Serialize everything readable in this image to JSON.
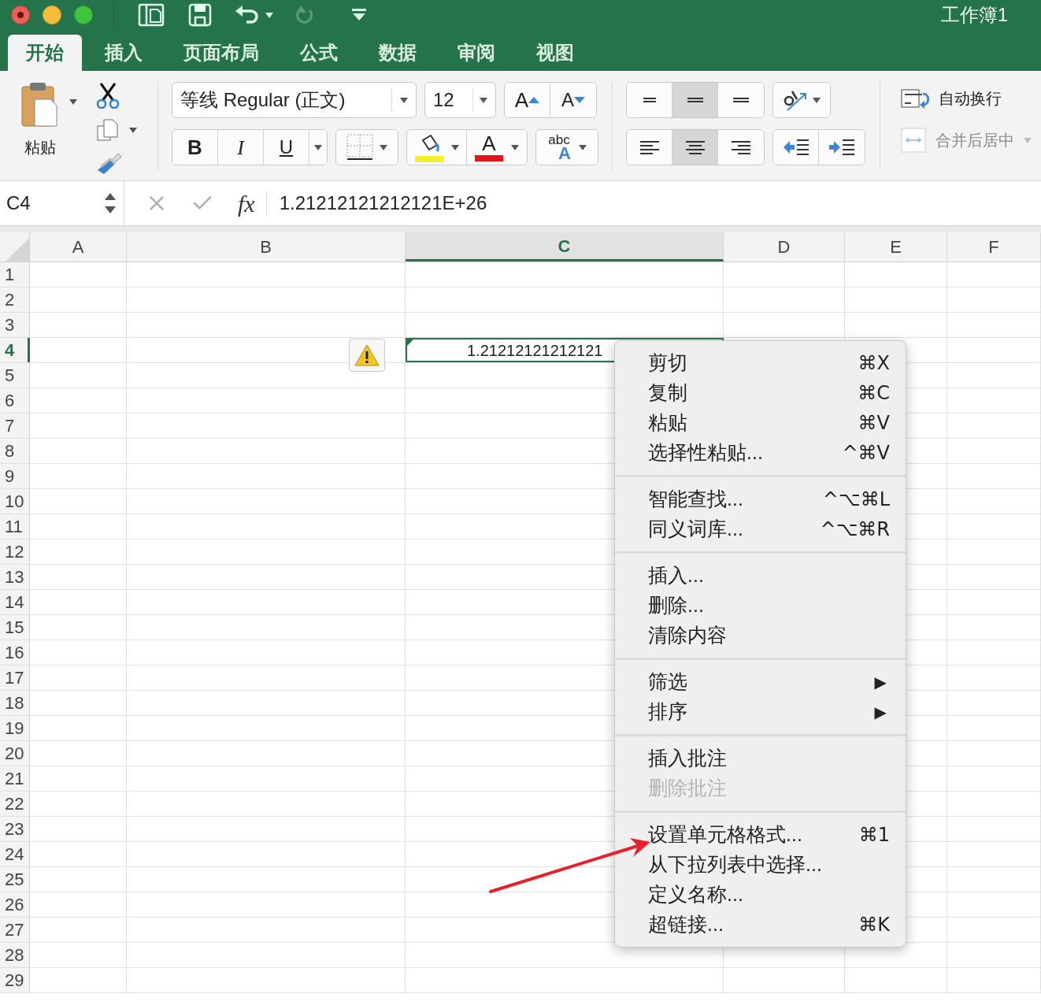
{
  "window": {
    "title": "工作簿1"
  },
  "quick_access": {
    "redo": {
      "disabled": true
    }
  },
  "ribbon_tabs": [
    {
      "label": "开始",
      "selected": true
    },
    {
      "label": "插入",
      "selected": false
    },
    {
      "label": "页面布局",
      "selected": false
    },
    {
      "label": "公式",
      "selected": false
    },
    {
      "label": "数据",
      "selected": false
    },
    {
      "label": "审阅",
      "selected": false
    },
    {
      "label": "视图",
      "selected": false
    }
  ],
  "ribbon": {
    "paste_label": "粘贴",
    "font_name": "等线 Regular (正文)",
    "font_size": "12",
    "grow_font": "A",
    "shrink_font": "A",
    "bold": "B",
    "italic": "I",
    "underline": "U",
    "font_color_letter": "A",
    "text_effects": {
      "top": "abc",
      "bottom": "A"
    },
    "vertical_align": [
      {
        "selected": false
      },
      {
        "selected": true
      },
      {
        "selected": false
      }
    ],
    "horizontal_align": [
      {
        "selected": false
      },
      {
        "selected": true
      },
      {
        "selected": false
      }
    ],
    "wrap_text": {
      "label": "自动换行",
      "disabled": false
    },
    "merge_center": {
      "label": "合并后居中",
      "disabled": true
    }
  },
  "formula_bar": {
    "name_box": "C4",
    "fx": "fx",
    "value": "1.21212121212121E+26"
  },
  "sheet": {
    "columns": [
      {
        "label": "A",
        "selected": false
      },
      {
        "label": "B",
        "selected": false
      },
      {
        "label": "C",
        "selected": true
      },
      {
        "label": "D",
        "selected": false
      },
      {
        "label": "E",
        "selected": false
      },
      {
        "label": "F",
        "selected": false
      }
    ],
    "rows": [
      {
        "label": "1",
        "selected": false
      },
      {
        "label": "2",
        "selected": false
      },
      {
        "label": "3",
        "selected": false
      },
      {
        "label": "4",
        "selected": true
      },
      {
        "label": "5",
        "selected": false
      },
      {
        "label": "6",
        "selected": false
      },
      {
        "label": "7",
        "selected": false
      },
      {
        "label": "8",
        "selected": false
      },
      {
        "label": "9",
        "selected": false
      },
      {
        "label": "10",
        "selected": false
      },
      {
        "label": "11",
        "selected": false
      },
      {
        "label": "12",
        "selected": false
      },
      {
        "label": "13",
        "selected": false
      },
      {
        "label": "14",
        "selected": false
      },
      {
        "label": "15",
        "selected": false
      },
      {
        "label": "16",
        "selected": false
      },
      {
        "label": "17",
        "selected": false
      },
      {
        "label": "18",
        "selected": false
      },
      {
        "label": "19",
        "selected": false
      },
      {
        "label": "20",
        "selected": false
      },
      {
        "label": "21",
        "selected": false
      },
      {
        "label": "22",
        "selected": false
      },
      {
        "label": "23",
        "selected": false
      },
      {
        "label": "24",
        "selected": false
      },
      {
        "label": "25",
        "selected": false
      },
      {
        "label": "26",
        "selected": false
      },
      {
        "label": "27",
        "selected": false
      },
      {
        "label": "28",
        "selected": false
      },
      {
        "label": "29",
        "selected": false
      }
    ],
    "active_cell": {
      "text": "1.21212121212121"
    }
  },
  "context_menu": {
    "groups": [
      {
        "items": [
          {
            "kind": "command",
            "label": "剪切",
            "shortcut": "⌘X",
            "disabled": false
          },
          {
            "kind": "command",
            "label": "复制",
            "shortcut": "⌘C",
            "disabled": false
          },
          {
            "kind": "command",
            "label": "粘贴",
            "shortcut": "⌘V",
            "disabled": false
          },
          {
            "kind": "command",
            "label": "选择性粘贴...",
            "shortcut": "^⌘V",
            "disabled": false
          }
        ]
      },
      {
        "items": [
          {
            "kind": "command",
            "label": "智能查找...",
            "shortcut": "^⌥⌘L",
            "disabled": false
          },
          {
            "kind": "command",
            "label": "同义词库...",
            "shortcut": "^⌥⌘R",
            "disabled": false
          }
        ]
      },
      {
        "items": [
          {
            "kind": "command",
            "label": "插入...",
            "disabled": false
          },
          {
            "kind": "command",
            "label": "删除...",
            "disabled": false
          },
          {
            "kind": "command",
            "label": "清除内容",
            "disabled": false
          }
        ]
      },
      {
        "items": [
          {
            "kind": "submenu",
            "label": "筛选",
            "arrow": "▶",
            "disabled": false
          },
          {
            "kind": "submenu",
            "label": "排序",
            "arrow": "▶",
            "disabled": false
          }
        ]
      },
      {
        "items": [
          {
            "kind": "command",
            "label": "插入批注",
            "disabled": false
          },
          {
            "kind": "command",
            "label": "删除批注",
            "disabled": true
          }
        ]
      },
      {
        "items": [
          {
            "kind": "command",
            "label": "设置单元格格式...",
            "shortcut": "⌘1",
            "disabled": false
          },
          {
            "kind": "command",
            "label": "从下拉列表中选择...",
            "disabled": false
          },
          {
            "kind": "command",
            "label": "定义名称...",
            "disabled": false
          },
          {
            "kind": "command",
            "label": "超链接...",
            "shortcut": "⌘K",
            "disabled": false
          }
        ]
      }
    ]
  }
}
